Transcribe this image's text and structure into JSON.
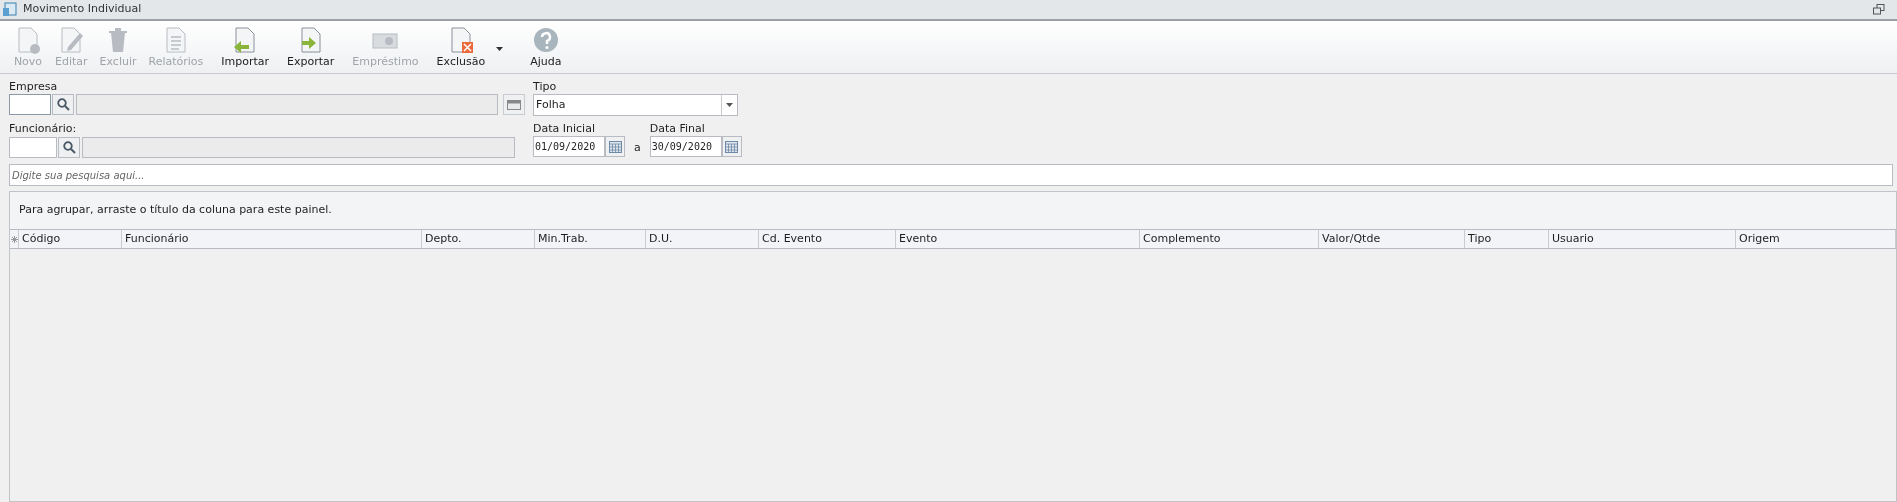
{
  "window": {
    "title": "Movimento Individual"
  },
  "toolbar": [
    {
      "label": "Novo",
      "kind": "new",
      "disabled": true,
      "dropdown": false
    },
    {
      "label": "Editar",
      "kind": "edit",
      "disabled": true,
      "dropdown": false
    },
    {
      "label": "Excluir",
      "kind": "trash",
      "disabled": true,
      "dropdown": false
    },
    {
      "label": "Relatórios",
      "kind": "report",
      "disabled": true,
      "dropdown": false
    },
    {
      "label": "Importar",
      "kind": "import",
      "disabled": false,
      "dropdown": false
    },
    {
      "label": "Exportar",
      "kind": "export",
      "disabled": false,
      "dropdown": false
    },
    {
      "label": "Empréstimo",
      "kind": "money",
      "disabled": true,
      "dropdown": false
    },
    {
      "label": "Exclusão",
      "kind": "delete",
      "disabled": false,
      "dropdown": true
    },
    {
      "label": "Ajuda",
      "kind": "help",
      "disabled": false,
      "dropdown": false
    }
  ],
  "filters": {
    "empresa": {
      "label": "Empresa"
    },
    "tipo": {
      "label": "Tipo",
      "value": "Folha"
    },
    "funcionario": {
      "label": "Funcionário:"
    },
    "data_inicial": {
      "label": "Data Inicial",
      "value": "01/09/2020"
    },
    "separator": "a",
    "data_final": {
      "label": "Data Final",
      "value": "30/09/2020"
    }
  },
  "search": {
    "placeholder": "Digite sua pesquisa aqui..."
  },
  "group_panel": {
    "text": "Para agrupar, arraste o título da coluna para este painel."
  },
  "table": {
    "columns": [
      "Código",
      "Funcionário",
      "Depto.",
      "Min.Trab.",
      "D.U.",
      "Cd. Evento",
      "Evento",
      "Complemento",
      "Valor/Qtde",
      "Tipo",
      "Usuario",
      "Origem"
    ]
  }
}
